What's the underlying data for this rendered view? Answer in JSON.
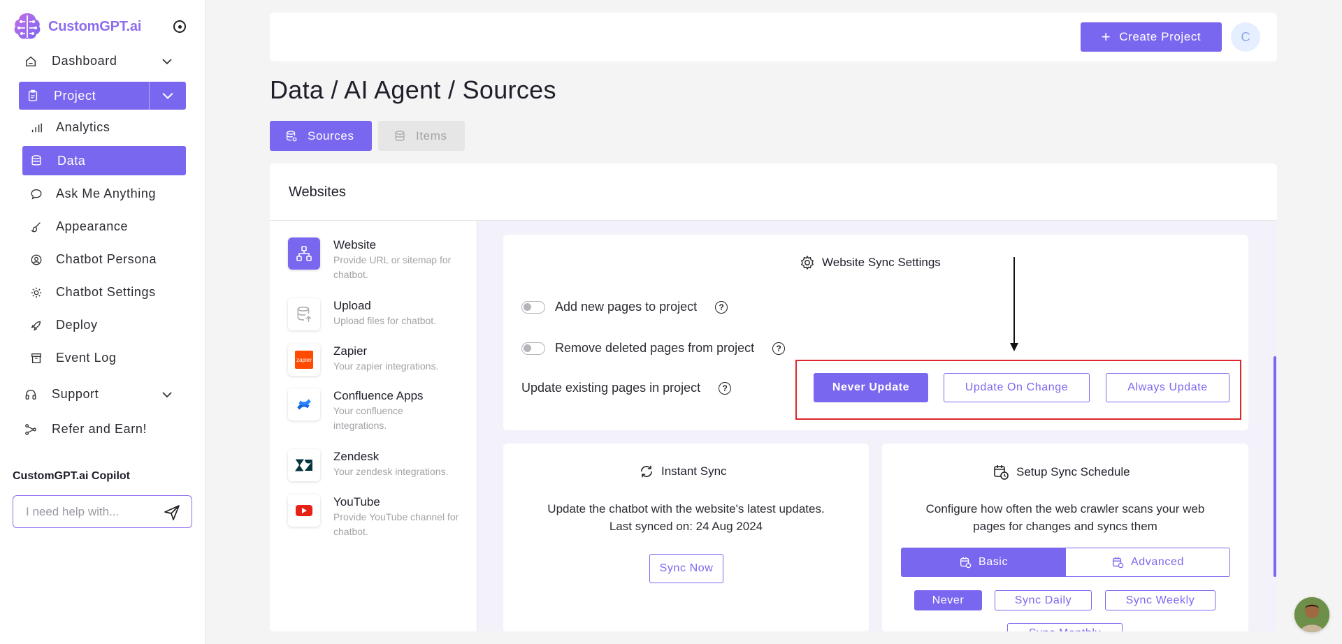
{
  "app": {
    "name": "CustomGPT.ai"
  },
  "sidebar": {
    "dashboard": "Dashboard",
    "project": "Project",
    "items": [
      "Analytics",
      "Data",
      "Ask Me Anything",
      "Appearance",
      "Chatbot Persona",
      "Chatbot Settings",
      "Deploy",
      "Event Log"
    ],
    "support": "Support",
    "refer": "Refer and Earn!",
    "copilot_title": "CustomGPT.ai Copilot",
    "copilot_placeholder": "I need help with..."
  },
  "header": {
    "create_project": "Create Project",
    "avatar_initial": "C"
  },
  "page": {
    "title": "Data / AI Agent / Sources",
    "tabs": [
      "Sources",
      "Items"
    ]
  },
  "websites": {
    "title": "Websites",
    "sources": [
      {
        "name": "Website",
        "desc": "Provide URL or sitemap for chatbot."
      },
      {
        "name": "Upload",
        "desc": "Upload files for chatbot."
      },
      {
        "name": "Zapier",
        "desc": "Your zapier integrations."
      },
      {
        "name": "Confluence Apps",
        "desc": "Your confluence integrations."
      },
      {
        "name": "Zendesk",
        "desc": "Your zendesk integrations."
      },
      {
        "name": "YouTube",
        "desc": "Provide YouTube channel for chatbot."
      }
    ],
    "sync_settings": {
      "title": "Website Sync Settings",
      "add_new": "Add new pages to project",
      "remove_deleted": "Remove deleted pages from project",
      "update_existing": "Update existing pages in project",
      "options": [
        "Never Update",
        "Update On Change",
        "Always Update"
      ],
      "selected": "Never Update"
    },
    "instant_sync": {
      "title": "Instant Sync",
      "desc_line1": "Update the chatbot with the website's latest updates.",
      "desc_line2": "Last synced on: 24 Aug 2024",
      "button": "Sync Now"
    },
    "schedule": {
      "title": "Setup Sync Schedule",
      "desc_line1": "Configure how often the web crawler scans your web",
      "desc_line2": "pages for changes and syncs them",
      "modes": [
        "Basic",
        "Advanced"
      ],
      "frequencies": [
        "Never",
        "Sync Daily",
        "Sync Weekly",
        "Sync Monthly"
      ]
    }
  },
  "colors": {
    "accent": "#7a67f0",
    "highlight": "#e0262a"
  }
}
